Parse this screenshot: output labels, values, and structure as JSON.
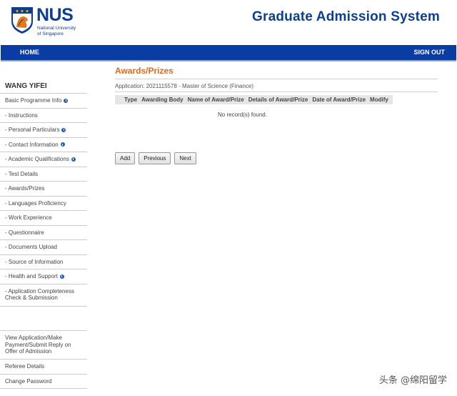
{
  "header": {
    "logo_text": "NUS",
    "logo_subtitle_line1": "National University",
    "logo_subtitle_line2": "of Singapore",
    "system_title": "Graduate Admission System"
  },
  "nav": {
    "home": "HOME",
    "sign_out": "SIGN OUT"
  },
  "sidebar": {
    "user_name": "WANG YIFEI",
    "items": [
      {
        "label": "Basic Programme Info",
        "info": true
      },
      {
        "label": "- Instructions",
        "info": false
      },
      {
        "label": "- Personal Particulars",
        "info": true
      },
      {
        "label": "- Contact Information",
        "info": true
      },
      {
        "label": "- Academic Qualifications",
        "info": true
      },
      {
        "label": "- Test Details",
        "info": false
      },
      {
        "label": "- Awards/Prizes",
        "info": false
      },
      {
        "label": "- Languages Proficiency",
        "info": false
      },
      {
        "label": "- Work Experience",
        "info": false
      },
      {
        "label": "- Questionnaire",
        "info": false
      },
      {
        "label": "- Documents Upload",
        "info": false
      },
      {
        "label": "- Source of Information",
        "info": false
      },
      {
        "label": "- Health and Support",
        "info": true
      },
      {
        "label": "- Application Completeness Check & Submission",
        "info": false
      }
    ],
    "bottom_items": [
      {
        "label": "View Application/Make Payment/Submit Reply on Offer of Admission"
      },
      {
        "label": "Referee Details"
      },
      {
        "label": "Change Password"
      }
    ]
  },
  "main": {
    "title": "Awards/Prizes",
    "application_info": "Application: 2021115578 - Master of Science (Finance)",
    "table": {
      "columns": [
        "Type",
        "Awarding Body",
        "Name of Award/Prize",
        "Details of Award/Prize",
        "Date of Award/Prize",
        "Modify"
      ],
      "empty_text": "No record(s) found."
    },
    "buttons": {
      "add": "Add",
      "previous": "Previous",
      "next": "Next"
    }
  },
  "watermark": "头条 @绵阳留学",
  "colors": {
    "brand_blue": "#0e3f8f",
    "nav_blue": "#0a3da3",
    "title_orange": "#e06a1b"
  }
}
